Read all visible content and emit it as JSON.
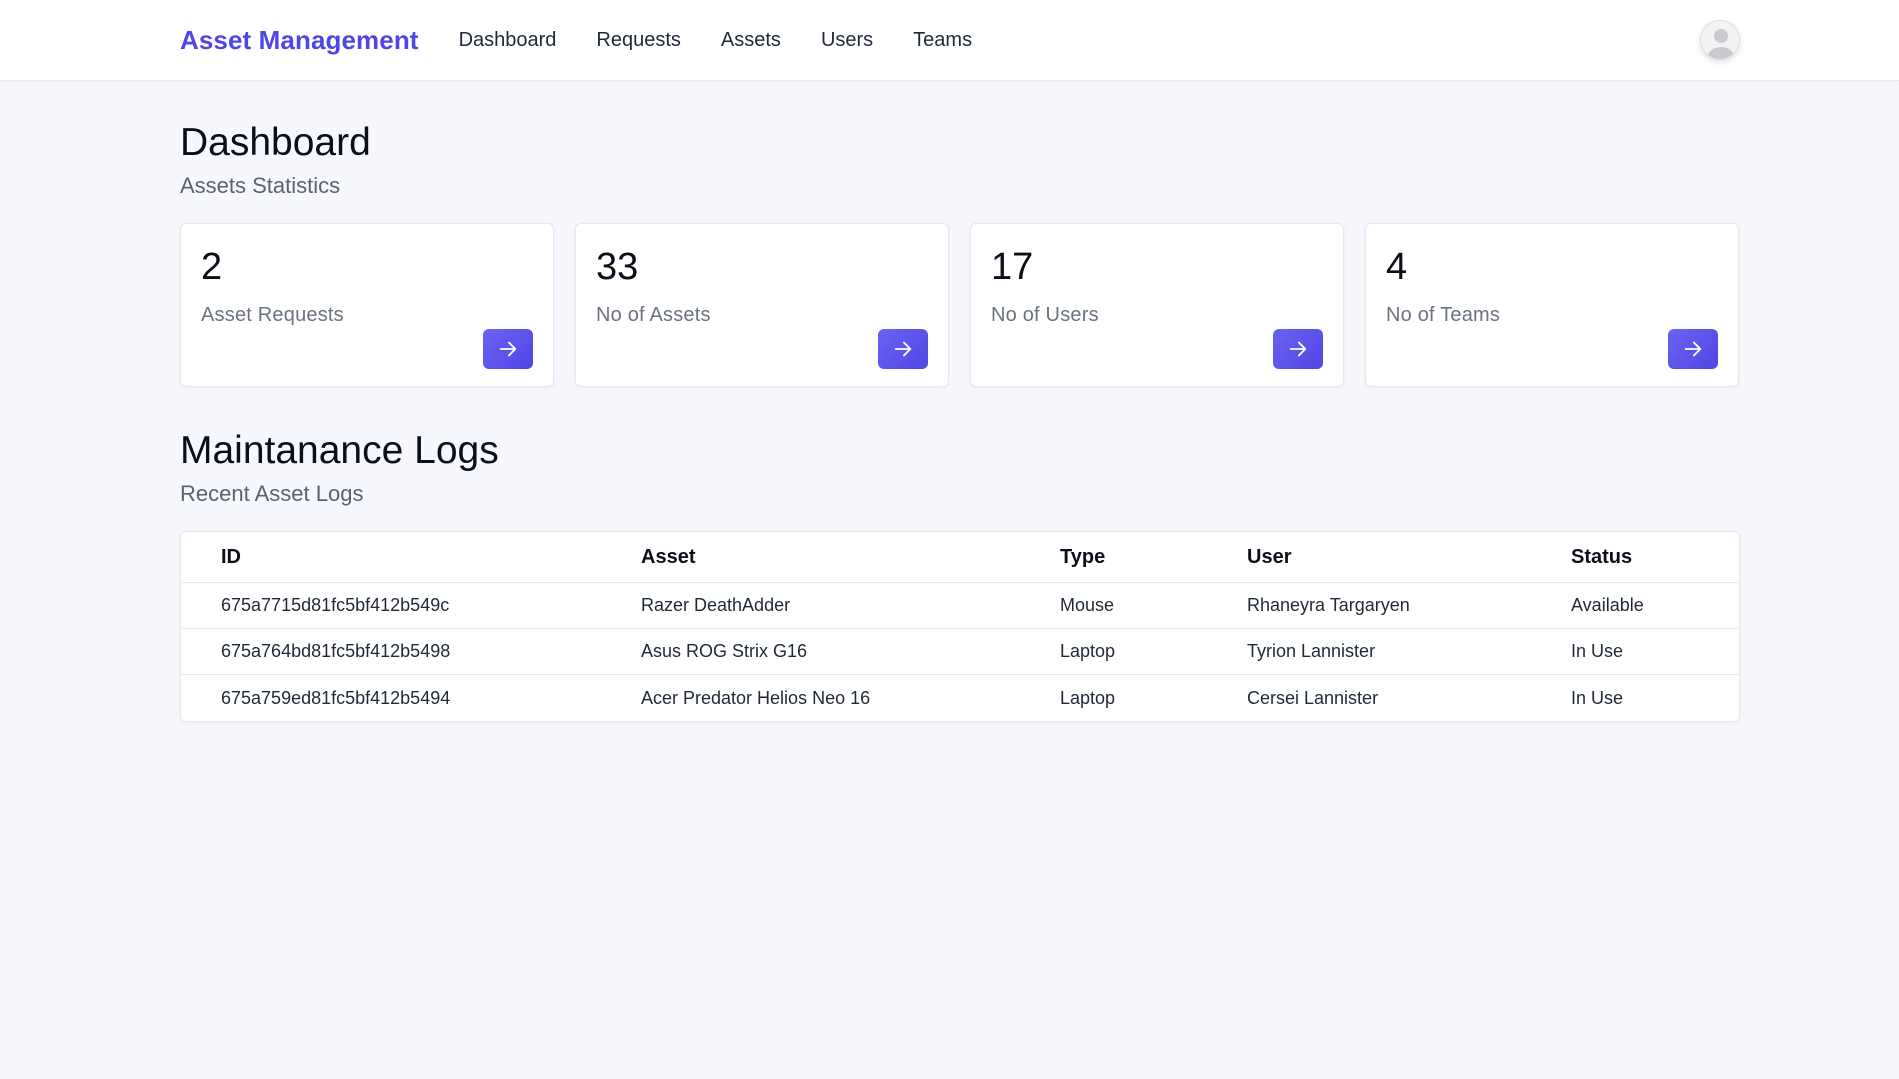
{
  "navbar": {
    "brand": "Asset Management",
    "links": [
      "Dashboard",
      "Requests",
      "Assets",
      "Users",
      "Teams"
    ]
  },
  "dashboard": {
    "title": "Dashboard",
    "subtitle": "Assets Statistics",
    "stats": [
      {
        "value": "2",
        "label": "Asset Requests"
      },
      {
        "value": "33",
        "label": "No of Assets"
      },
      {
        "value": "17",
        "label": "No of Users"
      },
      {
        "value": "4",
        "label": "No of Teams"
      }
    ]
  },
  "logs": {
    "title": "Maintanance Logs",
    "subtitle": "Recent Asset Logs",
    "headers": [
      "ID",
      "Asset",
      "Type",
      "User",
      "Status"
    ],
    "rows": [
      [
        "675a7715d81fc5bf412b549c",
        "Razer DeathAdder",
        "Mouse",
        "Rhaneyra Targaryen",
        "Available"
      ],
      [
        "675a764bd81fc5bf412b5498",
        "Asus ROG Strix G16",
        "Laptop",
        "Tyrion Lannister",
        "In Use"
      ],
      [
        "675a759ed81fc5bf412b5494",
        "Acer Predator Helios Neo 16",
        "Laptop",
        "Cersei Lannister",
        "In Use"
      ]
    ]
  },
  "icons": {
    "stat_button": "arrow-right-icon",
    "avatar": "user-avatar-icon"
  },
  "colors": {
    "accent": "#4f46e5",
    "background": "#f7f8fd"
  }
}
